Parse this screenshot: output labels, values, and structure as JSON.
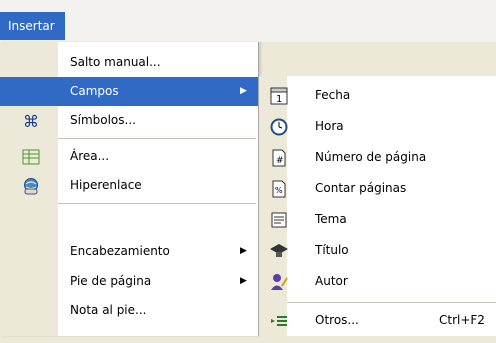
{
  "menubar": {
    "active": "Insertar"
  },
  "menu": {
    "items": [
      {
        "label": "Salto manual...",
        "icon": "none"
      },
      {
        "label": "Campos",
        "icon": "none",
        "submenu": true,
        "highlighted": true
      },
      {
        "label": "Símbolos...",
        "icon": "command-icon"
      },
      {
        "label": "Área...",
        "icon": "grid-icon"
      },
      {
        "label": "Hiperenlace",
        "icon": "globe-link-icon"
      },
      {
        "label": "Encabezamiento",
        "icon": "none",
        "submenu": true
      },
      {
        "label": "Pie de página",
        "icon": "none",
        "submenu": true
      },
      {
        "label": "Nota al pie...",
        "icon": "none"
      }
    ]
  },
  "submenu": {
    "items": [
      {
        "label": "Fecha",
        "icon": "calendar-icon"
      },
      {
        "label": "Hora",
        "icon": "clock-icon"
      },
      {
        "label": "Número de página",
        "icon": "page-number-icon"
      },
      {
        "label": "Contar páginas",
        "icon": "page-count-icon"
      },
      {
        "label": "Tema",
        "icon": "document-subject-icon"
      },
      {
        "label": "Título",
        "icon": "graduation-cap-icon"
      },
      {
        "label": "Autor",
        "icon": "author-icon"
      },
      {
        "label": "Otros...",
        "icon": "more-fields-icon",
        "shortcut": "Ctrl+F2"
      }
    ]
  },
  "colors": {
    "highlight": "#316ac5",
    "menu_bg": "#ffffff",
    "strip": "#ece9d8"
  }
}
